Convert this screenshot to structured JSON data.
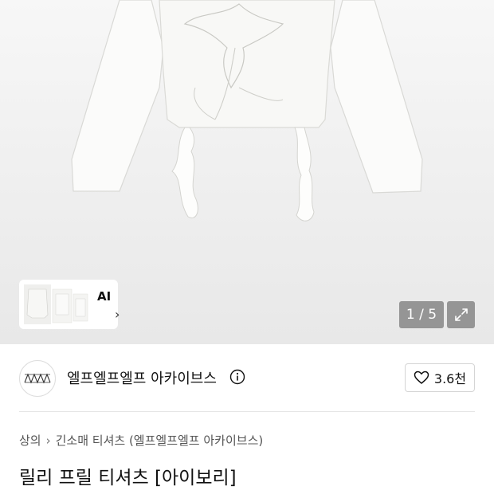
{
  "gallery": {
    "ai_label": "AI",
    "counter": "1 / 5"
  },
  "brand": {
    "name": "엘프엘프엘프 아카이브스",
    "like_count": "3.6천"
  },
  "breadcrumb": {
    "items": [
      "상의",
      "긴소매 티셔츠 (엘프엘프엘프 아카이브스)"
    ]
  },
  "product": {
    "title": "릴리 프릴 티셔츠 [아이보리]"
  },
  "icons": {
    "info": "info-icon",
    "heart": "heart-icon",
    "expand": "expand-icon",
    "chevron": "chevron-right-icon"
  }
}
